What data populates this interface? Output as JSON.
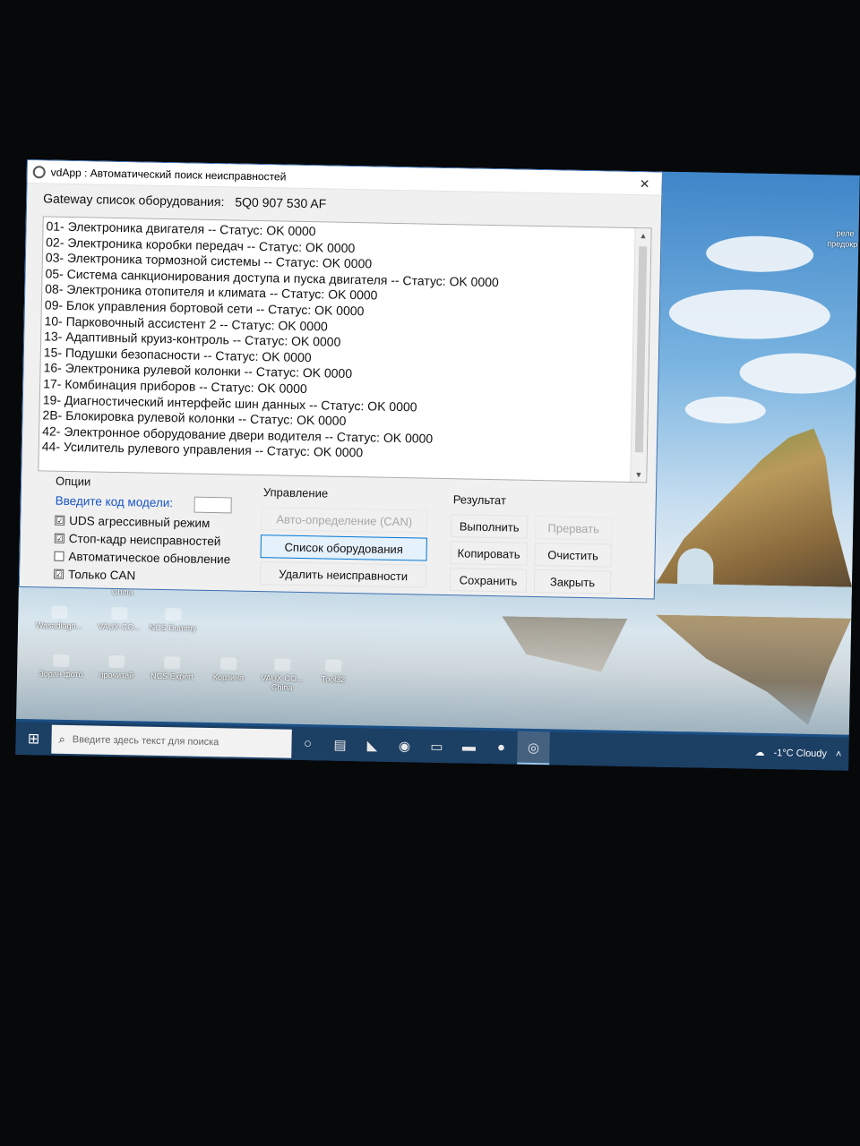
{
  "window": {
    "title": "vdApp : Автоматический поиск неисправностей",
    "close_glyph": "✕"
  },
  "gateway": {
    "label": "Gateway список оборудования:",
    "part_number": "5Q0 907 530 AF"
  },
  "modules": [
    "01- Электроника двигателя -- Статус: OK 0000",
    "02- Электроника коробки передач -- Статус: OK 0000",
    "03- Электроника тормозной системы -- Статус: OK 0000",
    "05- Система санкционирования доступа и пуска двигателя -- Статус: OK 0000",
    "08- Электроника отопителя и климата -- Статус: OK 0000",
    "09- Блок управления бортовой сети -- Статус: OK 0000",
    "10- Парковочный ассистент 2 -- Статус: OK 0000",
    "13- Адаптивный круиз-контроль -- Статус: OK 0000",
    "15- Подушки безопасности -- Статус: OK 0000",
    "16- Электроника рулевой колонки -- Статус: OK 0000",
    "17- Комбинация приборов -- Статус: OK 0000",
    "19- Диагностический интерфейс шин данных -- Статус: OK 0000",
    "2B- Блокировка рулевой колонки -- Статус: OK 0000",
    "42- Электронное оборудование двери водителя -- Статус: OK 0000",
    "44- Усилитель рулевого управления -- Статус: OK 0000"
  ],
  "options": {
    "group_label": "Опции",
    "model_code_label": "Введите код модели:",
    "model_code_value": "",
    "checkboxes": [
      {
        "label": "UDS агрессивный режим",
        "mark": "☑"
      },
      {
        "label": "Стоп-кадр неисправностей",
        "mark": "☑"
      },
      {
        "label": "Автоматическое обновление",
        "mark": ""
      },
      {
        "label": "Только CAN",
        "mark": "☑"
      }
    ]
  },
  "control": {
    "group_label": "Управление",
    "auto_detect": "Авто-определение (CAN)",
    "equipment_list": "Список оборудования",
    "delete_faults": "Удалить неисправности"
  },
  "result": {
    "group_label": "Результат",
    "run": "Выполнить",
    "abort": "Прервать",
    "copy": "Копировать",
    "clear": "Очистить",
    "save": "Сохранить",
    "close": "Закрыть"
  },
  "desktop": {
    "icons_row1": [
      "Wasadiagn...",
      "VAUX CO...",
      "NCS Dummy"
    ],
    "icons_row2": [
      "Зоран фото",
      "прочитай",
      "NCS Expert",
      "Корзина",
      "VAUX CO... China",
      "Tool32"
    ],
    "label_china": "China",
    "right_labels": [
      "реле",
      "предокр"
    ]
  },
  "taskbar": {
    "search_placeholder": "Введите здесь текст для поиска",
    "weather": "-1°C Cloudy",
    "accent_color": "#1c3f64"
  }
}
